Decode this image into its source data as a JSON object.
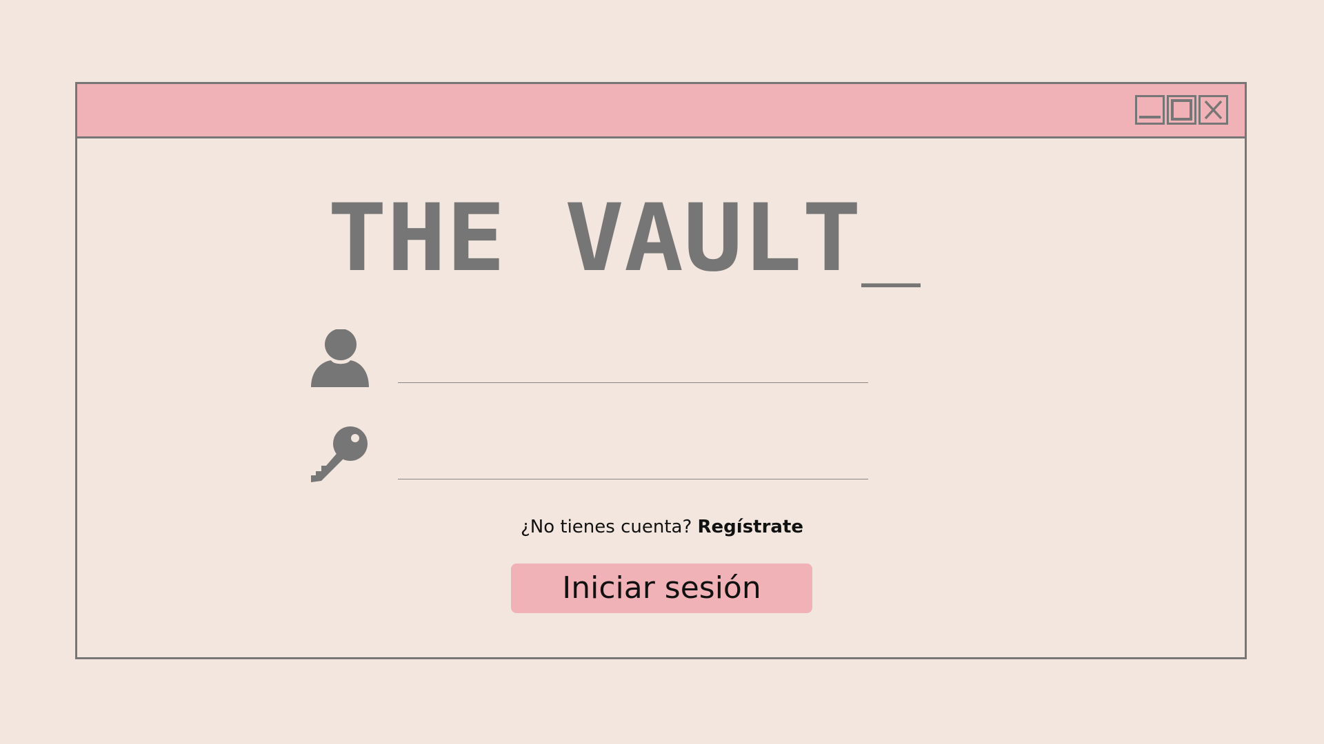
{
  "colors": {
    "background": "#f3e6de",
    "titlebar": "#f1b2b7",
    "border": "#767676",
    "button": "#f1b2b7"
  },
  "window": {
    "controls": [
      "minimize-icon",
      "maximize-icon",
      "close-icon"
    ]
  },
  "logo": {
    "text": "THE VAULT_"
  },
  "username": {
    "icon": "user-icon",
    "value": "",
    "placeholder": ""
  },
  "password": {
    "icon": "key-icon",
    "value": "",
    "placeholder": ""
  },
  "signup": {
    "prompt": "¿No tienes cuenta? ",
    "link": "Regístrate"
  },
  "login_button": {
    "label": "Iniciar sesión"
  }
}
